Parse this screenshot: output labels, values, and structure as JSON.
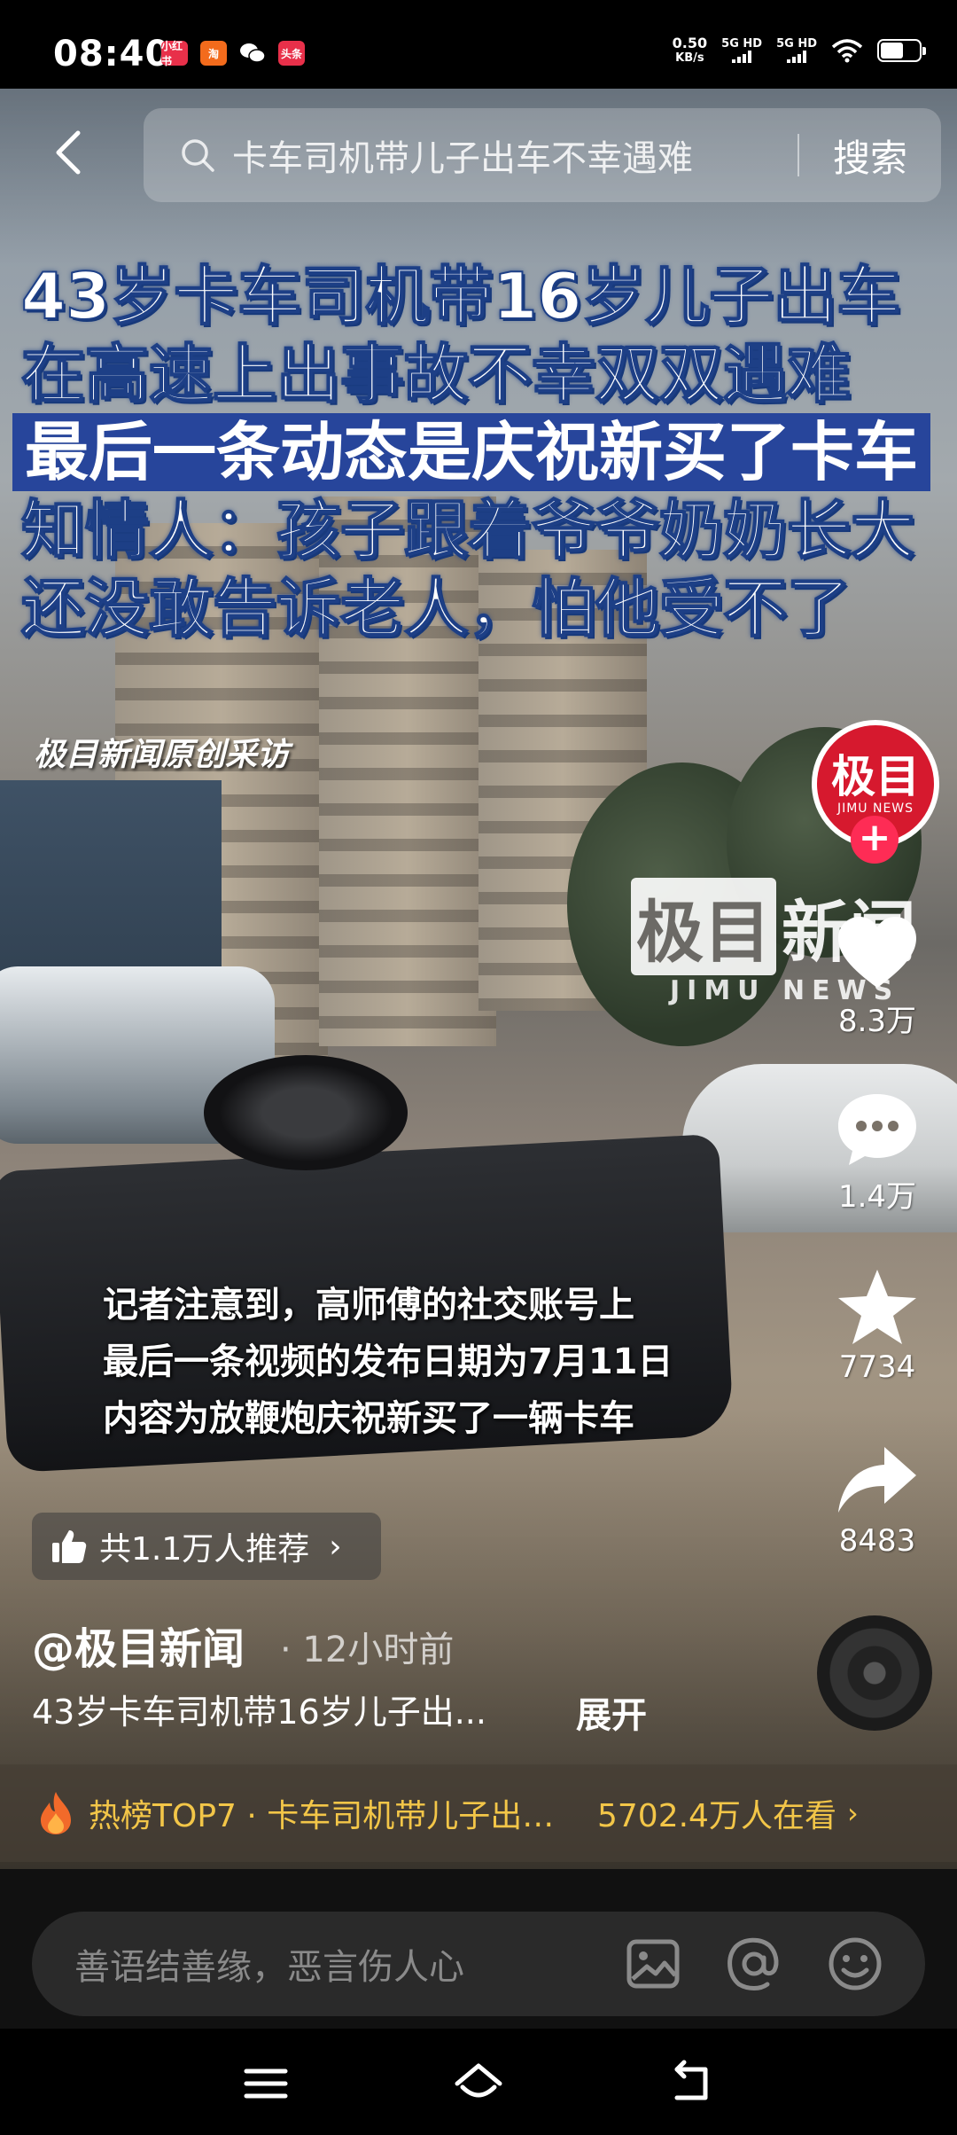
{
  "status_bar": {
    "time": "08:40",
    "app_icons": [
      {
        "name": "xiaohongshu-icon",
        "label": "小红书",
        "color": "#e8304a"
      },
      {
        "name": "taobao-icon",
        "label": "淘",
        "color": "#f36b1c"
      },
      {
        "name": "wechat-icon",
        "label": "",
        "color": "#ffffff"
      },
      {
        "name": "toutiao-icon",
        "label": "头条",
        "color": "#e8304a"
      }
    ],
    "net_speed_value": "0.50",
    "net_speed_unit": "KB/s",
    "signal1_label": "5G HD",
    "signal2_label": "5G HD"
  },
  "search": {
    "query": "卡车司机带儿子出车不幸遇难",
    "button_label": "搜索"
  },
  "headline": {
    "lines": [
      "43岁卡车司机带16岁儿子出车",
      "在高速上出事故不幸双双遇难",
      "最后一条动态是庆祝新买了卡车",
      "知情人：孩子跟着爷爷奶奶长大",
      "还没敢告诉老人，怕他受不了"
    ],
    "source": "极目新闻原创采访"
  },
  "watermark": {
    "zh_boxed": "极目",
    "zh_rest": "新闻",
    "en": "JIMU NEWS"
  },
  "caption": {
    "lines": [
      "记者注意到，高师傅的社交账号上",
      "最后一条视频的发布日期为7月11日",
      "内容为放鞭炮庆祝新买了一辆卡车"
    ]
  },
  "side_actions": {
    "avatar_main": "极目",
    "avatar_sub": "JIMU NEWS",
    "follow": "+",
    "likes": "8.3万",
    "comments": "1.4万",
    "favorites": "7734",
    "shares": "8483"
  },
  "recommend": {
    "text": "共1.1万人推荐",
    "chevron": "›"
  },
  "post": {
    "author": "@极目新闻",
    "time": "· 12小时前",
    "description": "43岁卡车司机带16岁儿子出...",
    "expand": "展开"
  },
  "hot": {
    "text": "热榜TOP7 · 卡车司机带儿子出…",
    "viewers": "5702.4万人在看",
    "chevron": "›"
  },
  "comment": {
    "placeholder": "善语结善缘，恶言伤人心"
  },
  "colors": {
    "headline_highlight": "#27459b",
    "hot_text": "#f3c648",
    "follow_button": "#fe2c55",
    "avatar_bg": "#d6192e"
  }
}
